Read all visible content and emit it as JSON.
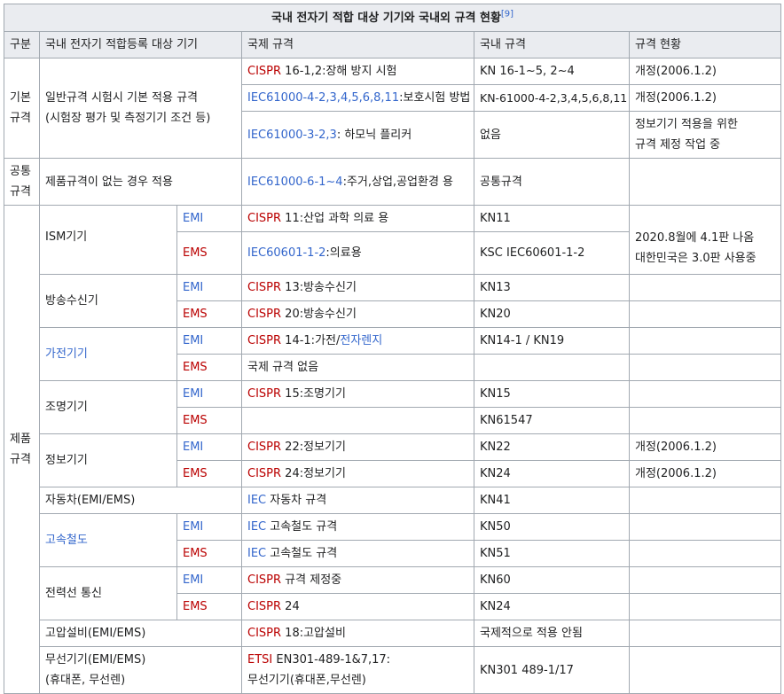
{
  "caption": "국내 전자기 적합 대상 기기와 국내외 규격 현황",
  "caption_ref": "[9]",
  "headers": [
    "구분",
    "국내 전자기 적합등록 대상 기기",
    "국제 규격",
    "국내 규격",
    "규격 현황"
  ],
  "categories": {
    "basic": [
      "기본",
      "규격"
    ],
    "common": [
      "공통",
      "규격"
    ],
    "product": [
      "제품",
      "규격"
    ]
  },
  "basic": {
    "device": [
      "일반규격 시험시 기본 적용 규격",
      "(시험장 평가 및 측정기기 조건 등)"
    ],
    "r1": {
      "intl_link": "CISPR",
      "intl_text": " 16-1,2:장해 방지 시험",
      "kr": "KN 16-1~5, 2~4",
      "status": "개정(2006.1.2)"
    },
    "r2": {
      "intl_link": "IEC61000-4-2,3,4,5,6,8,11",
      "intl_text": ":보호시험 방법",
      "kr": "KN-61000-4-2,3,4,5,6,8,11",
      "status": "개정(2006.1.2)"
    },
    "r3": {
      "intl_link": "IEC61000-3-2,3",
      "intl_text": ": 하모닉 플리커",
      "kr": "없음",
      "status": [
        "정보기기 적용을 위한",
        "규격 제정 작업 중"
      ]
    }
  },
  "common": {
    "device": "제품규격이 없는 경우 적용",
    "intl_link": "IEC61000-6-1~4",
    "intl_text": ":주거,상업,공업환경 용",
    "kr": "공통규격",
    "status": ""
  },
  "labels": {
    "emi": "EMI",
    "ems": "EMS"
  },
  "product": {
    "ism": {
      "name": "ISM기기",
      "emi": {
        "intl_link": "CISPR",
        "intl_text": " 11:산업 과학 의료 용",
        "kr": "KN11"
      },
      "ems": {
        "intl_link": "IEC60601-1-2",
        "intl_text": ":의료용",
        "kr": "KSC IEC60601-1-2",
        "status": [
          "2020.8월에 4.1판 나옴",
          "대한민국은 3.0판 사용중"
        ]
      }
    },
    "broadcast": {
      "name": "방송수신기",
      "emi": {
        "intl_link": "CISPR",
        "intl_text": " 13:방송수신기",
        "kr": "KN13"
      },
      "ems": {
        "intl_link": "CISPR",
        "intl_text": " 20:방송수신기",
        "kr": "KN20"
      }
    },
    "appliance": {
      "name": "가전기기",
      "emi": {
        "intl_link": "CISPR",
        "intl_text": " 14-1:가전/",
        "intl_link2": "전자렌지",
        "kr": "KN14-1 / KN19"
      },
      "ems": {
        "intl_text": "국제 규격 없음",
        "kr": ""
      }
    },
    "lighting": {
      "name": "조명기기",
      "emi": {
        "intl_link": "CISPR",
        "intl_text": " 15:조명기기",
        "kr": "KN15"
      },
      "ems": {
        "intl_text": "",
        "kr": "KN61547"
      }
    },
    "it": {
      "name": "정보기기",
      "emi": {
        "intl_link": "CISPR",
        "intl_text": " 22:정보기기",
        "kr": "KN22",
        "status": "개정(2006.1.2)"
      },
      "ems": {
        "intl_link": "CISPR",
        "intl_text": " 24:정보기기",
        "kr": "KN24",
        "status": "개정(2006.1.2)"
      }
    },
    "car": {
      "name": "자동차(EMI/EMS)",
      "intl_link": "IEC",
      "intl_text": " 자동차 규격",
      "kr": "KN41"
    },
    "rail": {
      "name": "고속철도",
      "emi": {
        "intl_link": "IEC",
        "intl_text": " 고속철도 규격",
        "kr": "KN50"
      },
      "ems": {
        "intl_link": "IEC",
        "intl_text": " 고속철도 규격",
        "kr": "KN51"
      }
    },
    "powerline": {
      "name": "전력선 통신",
      "emi": {
        "intl_link": "CISPR",
        "intl_text": " 규격 제정중",
        "kr": "KN60"
      },
      "ems": {
        "intl_link": "CISPR",
        "intl_text": " 24",
        "kr": "KN24"
      }
    },
    "hv": {
      "name": "고압설비(EMI/EMS)",
      "intl_link": "CISPR",
      "intl_text": " 18:고압설비",
      "kr": "국제적으로 적용 안됨"
    },
    "wireless": {
      "name": [
        "무선기기(EMI/EMS)",
        "(휴대폰, 무선렌)"
      ],
      "intl_link": "ETSI",
      "intl_text": " EN301-489-1&7,17:",
      "intl_text2": "무선기기(휴대폰,무선렌)",
      "kr": "KN301 489-1/17"
    }
  },
  "colors": {
    "link": "#3366cc",
    "red_link": "#ba0000",
    "header_bg": "#eaecf0",
    "border": "#a2a9b1",
    "text": "#202122"
  }
}
